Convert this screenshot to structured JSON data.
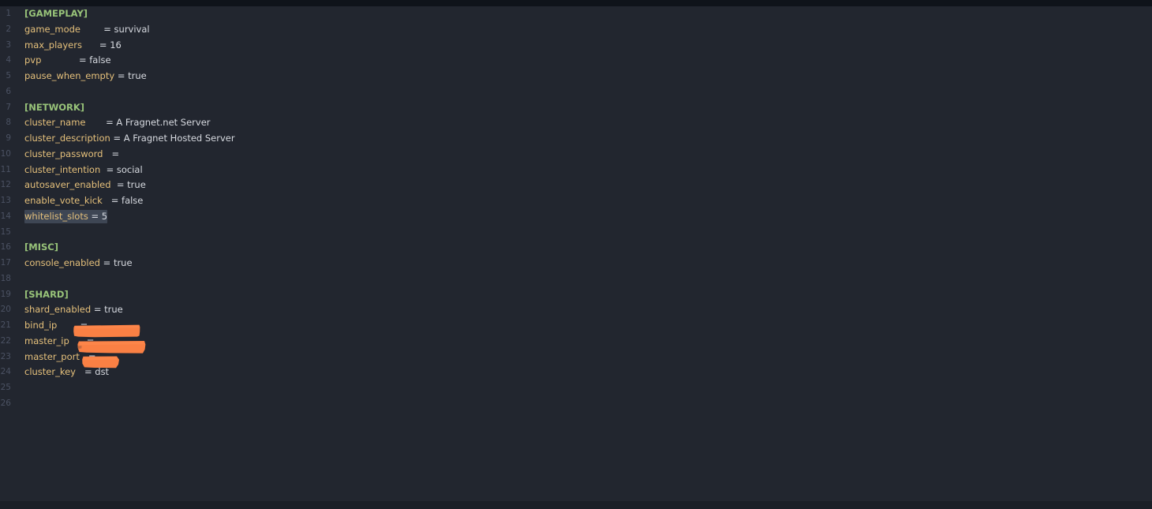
{
  "window": {
    "theme_background": "#22262f",
    "chrome_background": "#0f131a",
    "gutter_color": "#4b5263",
    "section_color": "#98c379",
    "key_color": "#e5c07b",
    "value_color": "#d7dae0",
    "selection_color": "#3e4654",
    "redaction_color": "#fa8044"
  },
  "editor": {
    "file_type": "ini-config",
    "total_lines": 26,
    "selected_line": 14,
    "lines": [
      {
        "n": "1",
        "kind": "section",
        "text": "[GAMEPLAY]"
      },
      {
        "n": "2",
        "kind": "pair",
        "key": "game_mode",
        "gap": "        ",
        "eq": "= ",
        "value": "survival"
      },
      {
        "n": "3",
        "kind": "pair",
        "key": "max_players",
        "gap": "      ",
        "eq": "= ",
        "value": "16"
      },
      {
        "n": "4",
        "kind": "pair",
        "key": "pvp",
        "gap": "             ",
        "eq": "= ",
        "value": "false"
      },
      {
        "n": "5",
        "kind": "pair",
        "key": "pause_when_empty",
        "gap": " ",
        "eq": "= ",
        "value": "true"
      },
      {
        "n": "6",
        "kind": "blank",
        "text": ""
      },
      {
        "n": "7",
        "kind": "section",
        "text": "[NETWORK]"
      },
      {
        "n": "8",
        "kind": "pair",
        "key": "cluster_name",
        "gap": "       ",
        "eq": "= ",
        "value": "A Fragnet.net Server"
      },
      {
        "n": "9",
        "kind": "pair",
        "key": "cluster_description",
        "gap": " ",
        "eq": "= ",
        "value": "A Fragnet Hosted Server"
      },
      {
        "n": "10",
        "kind": "pair",
        "key": "cluster_password",
        "gap": "   ",
        "eq": "=",
        "value": ""
      },
      {
        "n": "11",
        "kind": "pair",
        "key": "cluster_intention",
        "gap": "  ",
        "eq": "= ",
        "value": "social"
      },
      {
        "n": "12",
        "kind": "pair",
        "key": "autosaver_enabled",
        "gap": "  ",
        "eq": "= ",
        "value": "true"
      },
      {
        "n": "13",
        "kind": "pair",
        "key": "enable_vote_kick",
        "gap": "   ",
        "eq": "= ",
        "value": "false"
      },
      {
        "n": "14",
        "kind": "pair",
        "key": "whitelist_slots",
        "gap": " ",
        "eq": "= ",
        "value": "5",
        "selected": true
      },
      {
        "n": "15",
        "kind": "blank",
        "text": ""
      },
      {
        "n": "16",
        "kind": "section",
        "text": "[MISC]"
      },
      {
        "n": "17",
        "kind": "pair",
        "key": "console_enabled",
        "gap": " ",
        "eq": "= ",
        "value": "true"
      },
      {
        "n": "18",
        "kind": "blank",
        "text": ""
      },
      {
        "n": "19",
        "kind": "section",
        "text": "[SHARD]"
      },
      {
        "n": "20",
        "kind": "pair",
        "key": "shard_enabled",
        "gap": " ",
        "eq": "= ",
        "value": "true"
      },
      {
        "n": "21",
        "kind": "pair",
        "key": "bind_ip",
        "gap": "        ",
        "eq": "=",
        "value": "",
        "redacted": true
      },
      {
        "n": "22",
        "kind": "pair",
        "key": "master_ip",
        "gap": "      ",
        "eq": "=",
        "value": "",
        "redacted": true
      },
      {
        "n": "23",
        "kind": "pair",
        "key": "master_port",
        "gap": "   ",
        "eq": "=",
        "value": "",
        "redacted": true
      },
      {
        "n": "24",
        "kind": "pair",
        "key": "cluster_key",
        "gap": "   ",
        "eq": "= ",
        "value": "dst"
      },
      {
        "n": "25",
        "kind": "blank",
        "text": ""
      },
      {
        "n": "26",
        "kind": "blank",
        "text": ""
      }
    ]
  },
  "redactions": [
    {
      "name": "bind-ip-redaction",
      "line": 21
    },
    {
      "name": "master-ip-redaction",
      "line": 22
    },
    {
      "name": "master-port-redaction",
      "line": 23
    }
  ]
}
